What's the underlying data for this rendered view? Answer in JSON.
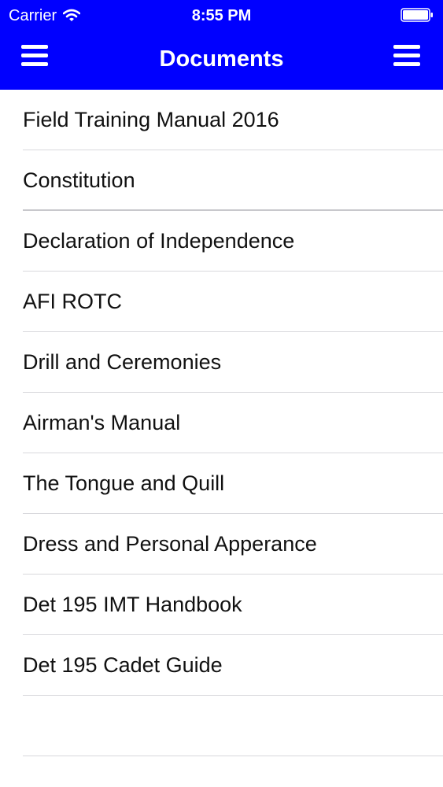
{
  "colors": {
    "nav_background": "#0000ff",
    "nav_text": "#ffffff",
    "list_text": "#111111",
    "separator": "#d8d8dc"
  },
  "status_bar": {
    "carrier": "Carrier",
    "time": "8:55 PM",
    "wifi_icon": "wifi-icon",
    "battery_icon": "battery-icon"
  },
  "nav_bar": {
    "title": "Documents",
    "left_button_icon": "hamburger-menu-icon",
    "right_button_icon": "hamburger-menu-icon"
  },
  "documents": [
    "Field Training Manual 2016",
    "Constitution",
    "Declaration of Independence",
    "AFI ROTC",
    "Drill and Ceremonies",
    "Airman's Manual",
    "The Tongue and Quill",
    "Dress and Personal Apperance",
    "Det 195 IMT Handbook",
    "Det 195 Cadet Guide"
  ]
}
